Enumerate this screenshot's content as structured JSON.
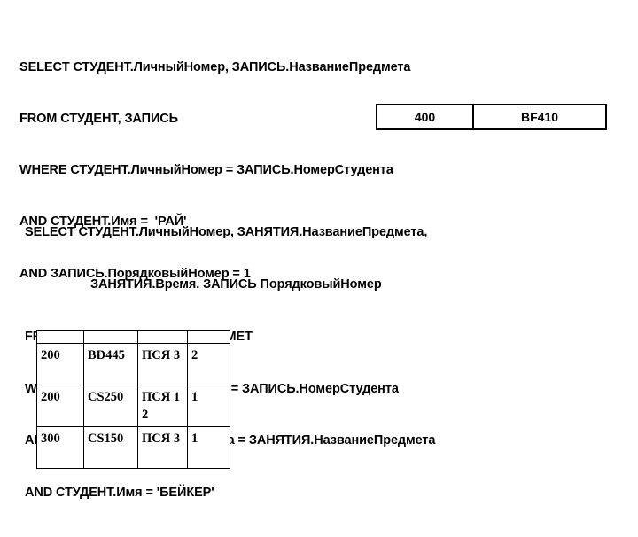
{
  "queries": [
    {
      "id": "query-1",
      "lines": [
        {
          "text": "SELECT СТУДЕНТ.ЛичныйНомер, ЗАПИСЬ.НазваниеПредмета",
          "indented": false
        },
        {
          "text": "FROM СТУДЕНТ, ЗАПИСЬ",
          "indented": false
        },
        {
          "text": "WHERE СТУДЕНТ.ЛичныйНомер = ЗАПИСЬ.НомерСтудента",
          "indented": false
        },
        {
          "text": "AND СТУДЕНТ.Имя =  'РАЙ'",
          "indented": false
        },
        {
          "text": "AND ЗАПИСЬ.ПорядковыйНомер = 1",
          "indented": false
        }
      ]
    },
    {
      "id": "query-2",
      "lines": [
        {
          "text": "SELECT СТУДЕНТ.ЛичныйНомер, ЗАНЯТИЯ.НазваниеПредмета,",
          "indented": false
        },
        {
          "text": "ЗАНЯТИЯ.Время. ЗАПИСЬ ПорядковыйНомер",
          "indented": true
        },
        {
          "text": "FROM СТУДЕНТ, ЗАПИСЬ, ПРЕДМЕТ",
          "indented": false
        },
        {
          "text": "WHERE СТУДЕНТ.ЛичныйНомер = ЗАПИСЬ.НомерСтудента",
          "indented": false
        },
        {
          "text": "AND ЗАПИСЬ.НазваниеПредмета = ЗАНЯТИЯ.НазваниеПредмета",
          "indented": false
        },
        {
          "text": "AND СТУДЕНТ.Имя = 'БЕЙКЕР'",
          "indented": false
        }
      ]
    }
  ],
  "result_table_top": {
    "rows": [
      {
        "cells": [
          "400",
          "BF410"
        ]
      }
    ]
  },
  "result_table_bottom": {
    "rows": [
      {
        "cells": [
          "200",
          "BD445",
          "ПСЯ 3",
          "2"
        ]
      },
      {
        "cells": [
          "200",
          "CS250",
          "ПСЯ 12",
          "1"
        ]
      },
      {
        "cells": [
          "300",
          "CS150",
          "ПСЯ 3",
          "1"
        ]
      }
    ]
  },
  "colors": {
    "text": "#000000",
    "background": "#ffffff",
    "border": "#000000"
  }
}
